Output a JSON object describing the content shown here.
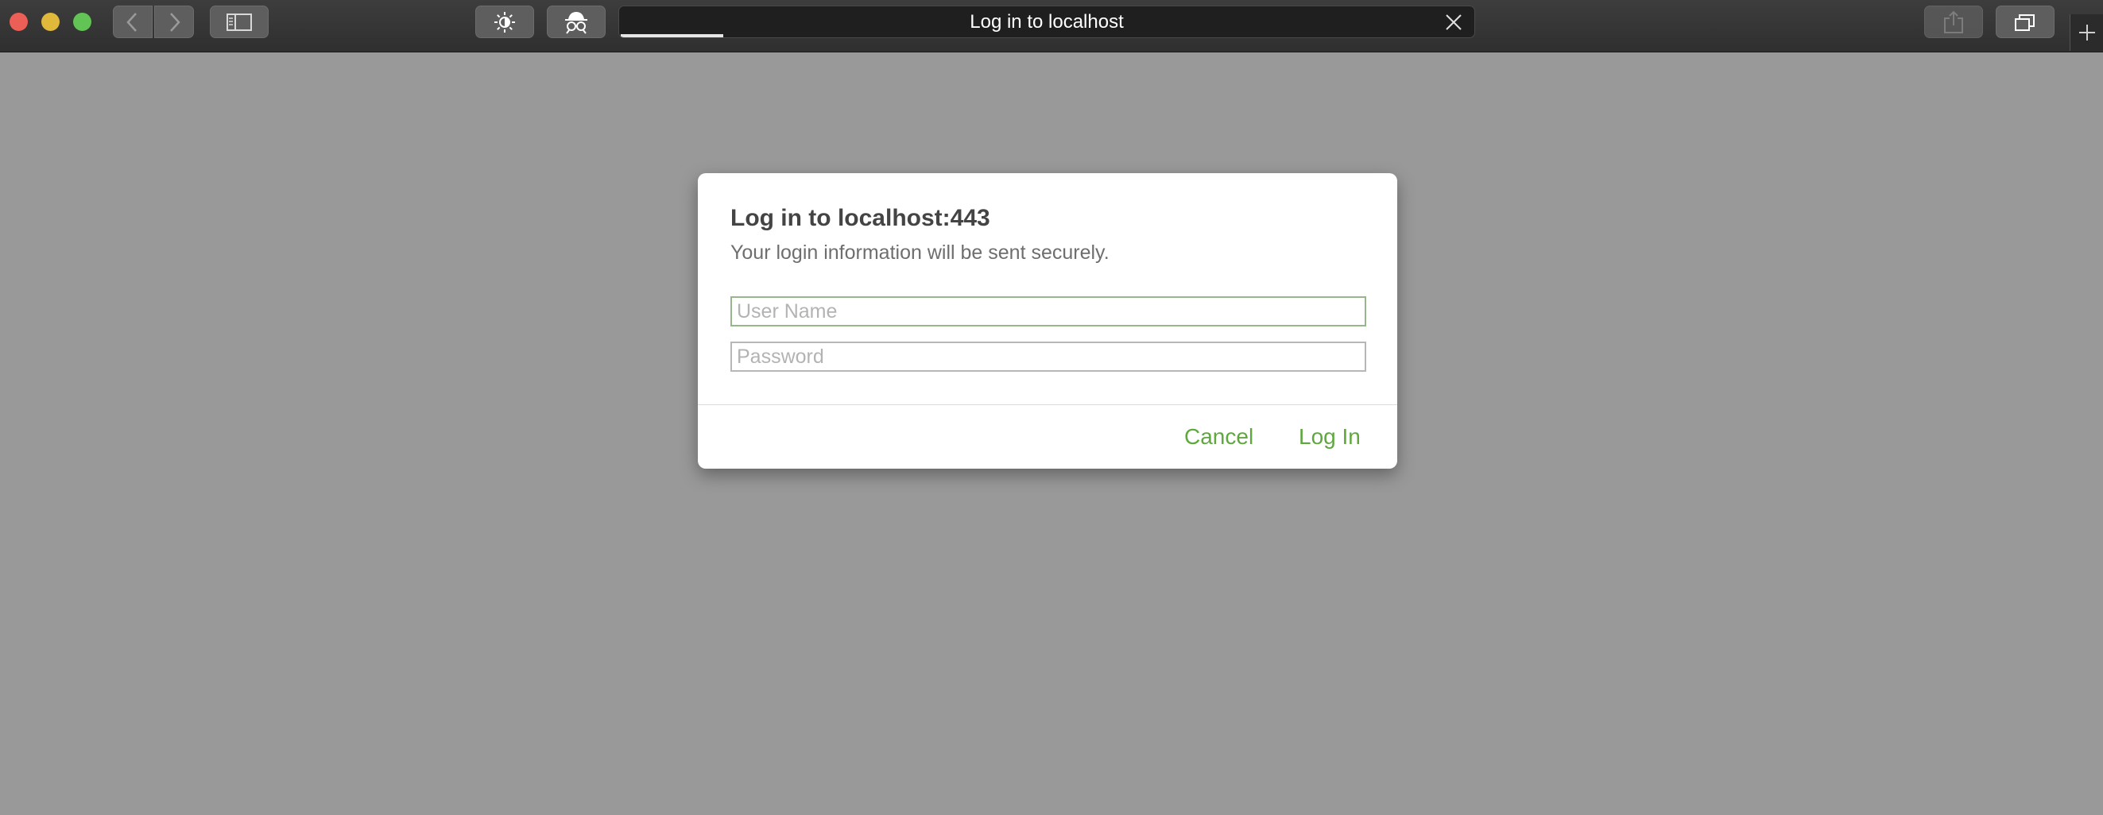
{
  "browser": {
    "tab_title": "Log in to localhost",
    "page_load_progress": 0.12,
    "icons": {
      "back": "chevron-left-icon",
      "forward": "chevron-right-icon",
      "sidebar": "sidebar-icon",
      "appearance": "brightness-icon",
      "private": "spy-icon",
      "stop": "close-icon",
      "share": "share-icon",
      "tabs": "tab-overview-icon",
      "new_tab": "plus-icon"
    }
  },
  "dialog": {
    "title": "Log in to localhost:443",
    "subtitle": "Your login information will be sent securely.",
    "username_placeholder": "User Name",
    "password_placeholder": "Password",
    "cancel_label": "Cancel",
    "login_label": "Log In",
    "accent_color": "#5fa83f"
  }
}
